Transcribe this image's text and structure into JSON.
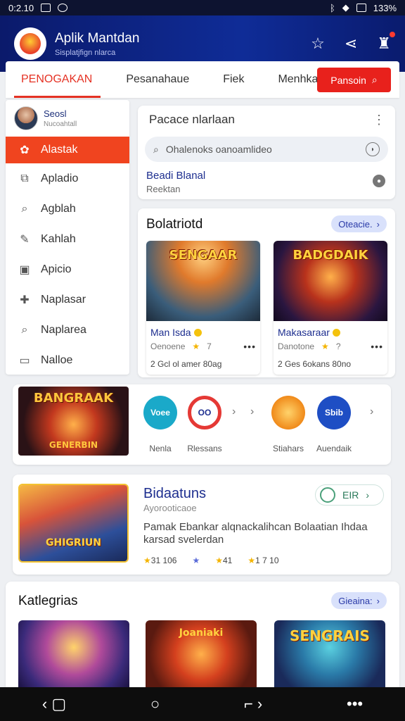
{
  "status_bar": {
    "time": "0:2.10",
    "battery": "133%"
  },
  "app_bar": {
    "title": "Aplik Mantdan",
    "subtitle": "Sisplatjfign nlarca"
  },
  "tabs": [
    {
      "label": "PENOGAKAN",
      "active": true
    },
    {
      "label": "Pesanahaue",
      "active": false
    },
    {
      "label": "Fiek",
      "active": false
    },
    {
      "label": "Menhkan",
      "active": false
    }
  ],
  "search_button": {
    "label": "Pansoin"
  },
  "sidebar": {
    "profile": {
      "name": "Seosl",
      "sub": "Nucoahtall"
    },
    "items": [
      {
        "label": "Alastak",
        "icon": "gear-icon",
        "active": true
      },
      {
        "label": "Apladio",
        "icon": "puzzle-icon",
        "active": false
      },
      {
        "label": "Agblah",
        "icon": "search-icon",
        "active": false
      },
      {
        "label": "Kahlah",
        "icon": "pencil-icon",
        "active": false
      },
      {
        "label": "Apicio",
        "icon": "calendar-icon",
        "active": false
      },
      {
        "label": "Naplasar",
        "icon": "gamepad-icon",
        "active": false
      },
      {
        "label": "Naplarea",
        "icon": "search-icon",
        "active": false
      },
      {
        "label": "Nalloe",
        "icon": "folder-icon",
        "active": false
      }
    ]
  },
  "search_panel": {
    "title": "Pacace nlarlaan",
    "placeholder": "Ohalenoks oanoamlideo",
    "result_title": "Beadi Blanal",
    "result_sub": "Reektan"
  },
  "games_panel": {
    "title": "Bolatriotd",
    "pill": "Oteacie.",
    "cards": [
      {
        "art_title": "SENGAAR",
        "name": "Man Isda",
        "publisher": "Oenoene",
        "rating": "7",
        "stats": "2 Gcl ol amer 80ag"
      },
      {
        "art_title": "BADGDAIK",
        "name": "Makasaraar",
        "publisher": "Danotone",
        "rating": "?",
        "stats": "2 Ges 6okans 80no"
      }
    ]
  },
  "apps_panel": {
    "promo_title": "BANGRAAK",
    "promo_bottom": "GENERBIN",
    "apps": [
      {
        "label": "Nenla",
        "badge": "Voee",
        "color": "#1aa9c9"
      },
      {
        "label": "Rlessans",
        "badge": "OO",
        "color": "#e53935"
      },
      {
        "label": "Stiahars",
        "badge": "",
        "color": "#f29a1c"
      },
      {
        "label": "Auendaik",
        "badge": "Sbib",
        "color": "#1e4ec4"
      }
    ]
  },
  "feature_panel": {
    "art_title": "GHIGRIUN",
    "title": "Bidaatuns",
    "sub": "Ayorooticaoe",
    "desc": "Pamak Ebankar alqnackalihcan Bolaatian Ihdaa karsad svelerdan",
    "pill": "EIR",
    "ratings": [
      "31 106",
      "",
      "41",
      "1 7 10"
    ]
  },
  "categories_panel": {
    "title": "Katlegrias",
    "pill": "Gieaina:",
    "cats": [
      {
        "art_title": ""
      },
      {
        "art_title": "Joaniaki"
      },
      {
        "art_title": "SENGRAIS"
      }
    ]
  },
  "colors": {
    "accent_red": "#e8211c",
    "header_blue": "#0f2c97",
    "link_blue": "#1d2e8f"
  }
}
